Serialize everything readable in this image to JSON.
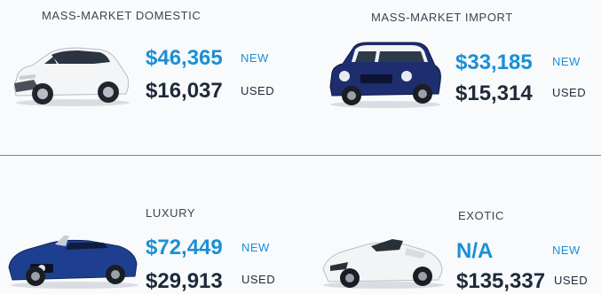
{
  "segments": [
    {
      "category": "MASS-MARKET DOMESTIC",
      "new_price": "$46,365",
      "new_label": "NEW",
      "used_price": "$16,037",
      "used_label": "USED",
      "icon": "white-hatchback-car-image"
    },
    {
      "category": "MASS-MARKET IMPORT",
      "new_price": "$33,185",
      "new_label": "NEW",
      "used_price": "$15,314",
      "used_label": "USED",
      "icon": "blue-mini-car-image"
    },
    {
      "category": "LUXURY",
      "new_price": "$72,449",
      "new_label": "NEW",
      "used_price": "$29,913",
      "used_label": "USED",
      "icon": "blue-convertible-car-image"
    },
    {
      "category": "EXOTIC",
      "new_price": "N/A",
      "new_label": "NEW",
      "used_price": "$135,337",
      "used_label": "USED",
      "icon": "white-sports-convertible-image"
    }
  ],
  "colors": {
    "accent": "#1a8fd6",
    "dark": "#1e2a3a",
    "divider": "#2aa0cf"
  }
}
